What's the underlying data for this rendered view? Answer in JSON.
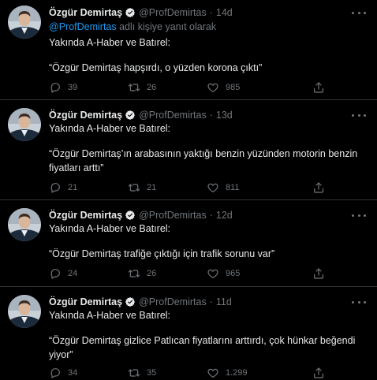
{
  "tweets": [
    {
      "author_name": "Özgür Demirtaş",
      "handle": "@ProfDemirtas",
      "separator": "·",
      "time": "14d",
      "reply_mention": "@ProfDemirtas",
      "reply_suffix": " adlı kişiye yanıt olarak",
      "text_line1": "Yakında A-Haber ve Batırel:",
      "text_line2": "“Özgür Demirtaş hapşırdı, o yüzden korona çıktı”",
      "replies": "39",
      "retweets": "26",
      "likes": "985"
    },
    {
      "author_name": "Özgür Demirtaş",
      "handle": "@ProfDemirtas",
      "separator": "·",
      "time": "13d",
      "text_line1": "Yakında A-Haber ve Batırel:",
      "text_line2": "“Özgür Demirtaş’ın arabasının yaktığı benzin yüzünden motorin benzin fiyatları arttı”",
      "replies": "21",
      "retweets": "21",
      "likes": "811"
    },
    {
      "author_name": "Özgür Demirtaş",
      "handle": "@ProfDemirtas",
      "separator": "·",
      "time": "12d",
      "text_line1": "Yakında A-Haber ve Batırel:",
      "text_line2": "“Özgür Demirtaş trafiğe çıktığı için trafik sorunu var”",
      "replies": "24",
      "retweets": "26",
      "likes": "965"
    },
    {
      "author_name": "Özgür Demirtaş",
      "handle": "@ProfDemirtas",
      "separator": "·",
      "time": "11d",
      "text_line1": "Yakında A-Haber ve Batırel:",
      "text_line2": "“Özgür Demirtaş gizlice Patlıcan fiyatlarını arttırdı, çok hünkar beğendi yiyor”",
      "replies": "34",
      "retweets": "35",
      "likes": "1.299"
    }
  ],
  "colors": {
    "background": "#000000",
    "text_primary": "#e7e9ea",
    "text_secondary": "#71767b",
    "accent": "#1d9bf0",
    "divider": "#2f3336"
  },
  "icons": {
    "verified": "verified-badge-icon",
    "more": "more-options-icon",
    "reply": "reply-icon",
    "retweet": "retweet-icon",
    "like": "like-icon",
    "share": "share-icon"
  }
}
